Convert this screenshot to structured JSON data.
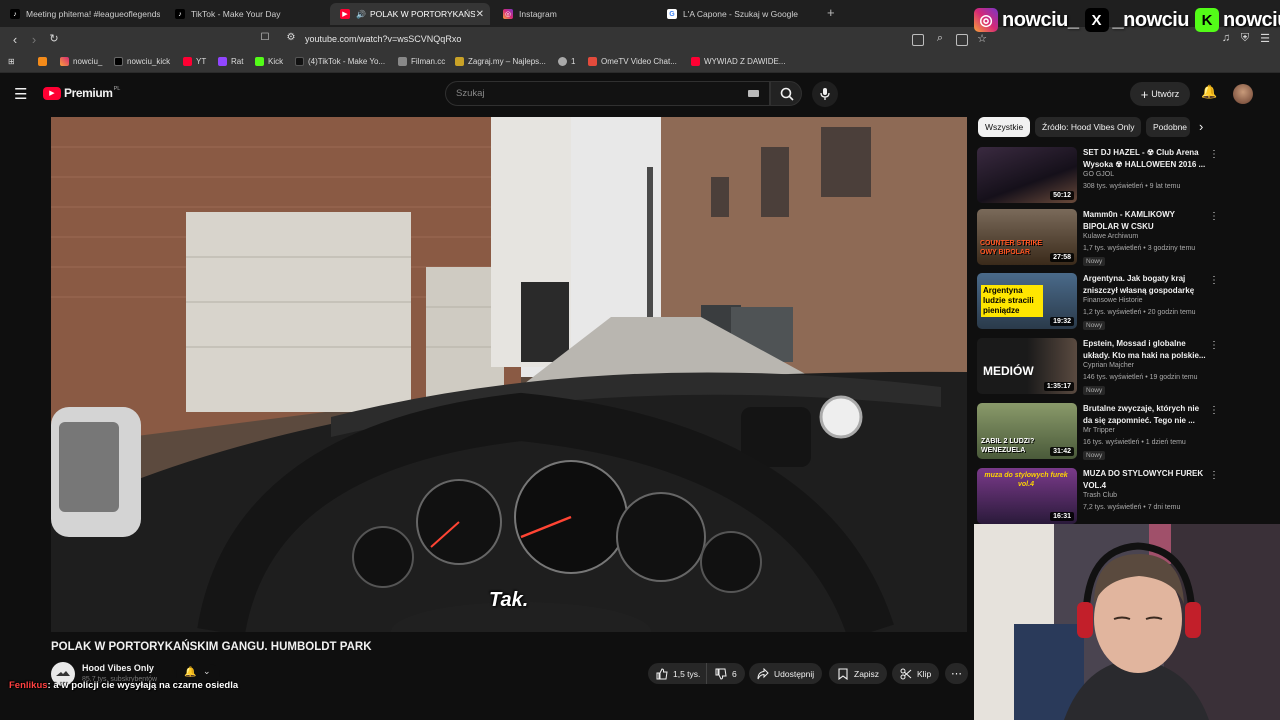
{
  "browser": {
    "tabs": [
      {
        "title": "Meeting phitema! #leagueoflegends",
        "icon": "tiktok-icon"
      },
      {
        "title": "TikTok - Make Your Day",
        "icon": "tiktok-icon"
      },
      {
        "title": "POLAK W PORTORYKAŃSKIM",
        "icon": "youtube-icon",
        "active": true
      },
      {
        "title": "Instagram",
        "icon": "instagram-icon"
      },
      {
        "title": "L'A Capone - Szukaj w Google",
        "icon": "google-icon"
      }
    ],
    "url": "youtube.com/watch?v=wsSCVNQqRxo",
    "bookmarks": [
      {
        "label": "",
        "icon": "rss-icon"
      },
      {
        "label": "nowciu_",
        "icon": "instagram-icon"
      },
      {
        "label": "nowciu_kick",
        "icon": "x-icon"
      },
      {
        "label": "YT",
        "icon": "youtube-icon"
      },
      {
        "label": "Rat",
        "icon": "twitch-icon"
      },
      {
        "label": "Kick",
        "icon": "kick-icon"
      },
      {
        "label": "(4)TikTok - Make Yo...",
        "icon": "tiktok-icon"
      },
      {
        "label": "Filman.cc",
        "icon": "film-icon"
      },
      {
        "label": "Zagraj.my – Najleps...",
        "icon": "person-icon"
      },
      {
        "label": "1",
        "icon": "globe-icon"
      },
      {
        "label": "OmeTV Video Chat...",
        "icon": "mail-icon"
      },
      {
        "label": "WYWIAD Z DAWIDE...",
        "icon": "youtube-icon"
      }
    ]
  },
  "socials": [
    {
      "handle": "nowciu_",
      "icon": "instagram-icon"
    },
    {
      "handle": "_nowciu",
      "icon": "x-icon"
    },
    {
      "handle": "nowciu",
      "icon": "kick-icon"
    }
  ],
  "youtube": {
    "logo_text": "Premium",
    "logo_region": "PL",
    "search_placeholder": "Szukaj",
    "create_label": "Utwórz"
  },
  "video": {
    "caption": "Tak.",
    "title": "POLAK W PORTORYKAŃSKIM GANGU. HUMBOLDT PARK",
    "channel": "Hood Vibes Only",
    "subscribers": "85,7 tys. subskrybentów",
    "likes": "1,5 tys.",
    "dislikes": "6",
    "share_label": "Udostępnij",
    "save_label": "Zapisz",
    "clip_label": "Klip"
  },
  "chat": {
    "user": "Fenlikus",
    "message": ": a w policji cie wysyłają na czarne osiedla"
  },
  "chips": [
    "Wszystkie",
    "Źródło: Hood Vibes Only",
    "Podobne"
  ],
  "recommendations": [
    {
      "title": "SET DJ HAZEL - ☢ Club Arena Wysoka ☢ HALLOWEEN 2016 ...",
      "channel": "GO GJOL",
      "meta": "308 tys. wyświetleń • 9 lat temu",
      "duration": "50:12",
      "badge": "",
      "thumb_color": "#2a2030"
    },
    {
      "title": "Mamm0n - KAMLIKOWY BIPOLAR W CSKU",
      "channel": "Kulawe Archiwum",
      "meta": "1,7 tys. wyświetleń • 3 godziny temu",
      "duration": "27:58",
      "badge": "Nowy",
      "thumb_color": "#4a3a2a",
      "thumb_text": "COUNTER STRIKE OWY BIPOLAR"
    },
    {
      "title": "Argentyna. Jak bogaty kraj zniszczył własną gospodarkę",
      "channel": "Finansowe Historie",
      "meta": "1,2 tys. wyświetleń • 20 godzin temu",
      "duration": "19:32",
      "badge": "Nowy",
      "thumb_color": "#3d5a7a",
      "thumb_text": "Argentyna ludzie stracili pieniądze"
    },
    {
      "title": "Epstein, Mossad i globalne układy. Kto ma haki na polskie...",
      "channel": "Cyprian Majcher",
      "meta": "146 tys. wyświetleń • 19 godzin temu",
      "duration": "1:35:17",
      "badge": "Nowy",
      "thumb_color": "#1c1c1c",
      "thumb_text": "MEDIÓW"
    },
    {
      "title": "Brutalne zwyczaje, których nie da się zapomnieć. Tego nie ...",
      "channel": "Mr Tripper",
      "meta": "16 tys. wyświetleń • 1 dzień temu",
      "duration": "31:42",
      "badge": "Nowy",
      "thumb_color": "#6b7d4a",
      "thumb_text": "ZABIŁ 2 LUDZI? WENEZUELA"
    },
    {
      "title": "MUZA DO STYLOWYCH FUREK VOL.4",
      "channel": "Trash Club",
      "meta": "7,2 tys. wyświetleń • 7 dni temu",
      "duration": "16:31",
      "badge": "",
      "thumb_color": "#5a2a6a",
      "thumb_text": "muza do stylowych furek vol.4"
    }
  ]
}
